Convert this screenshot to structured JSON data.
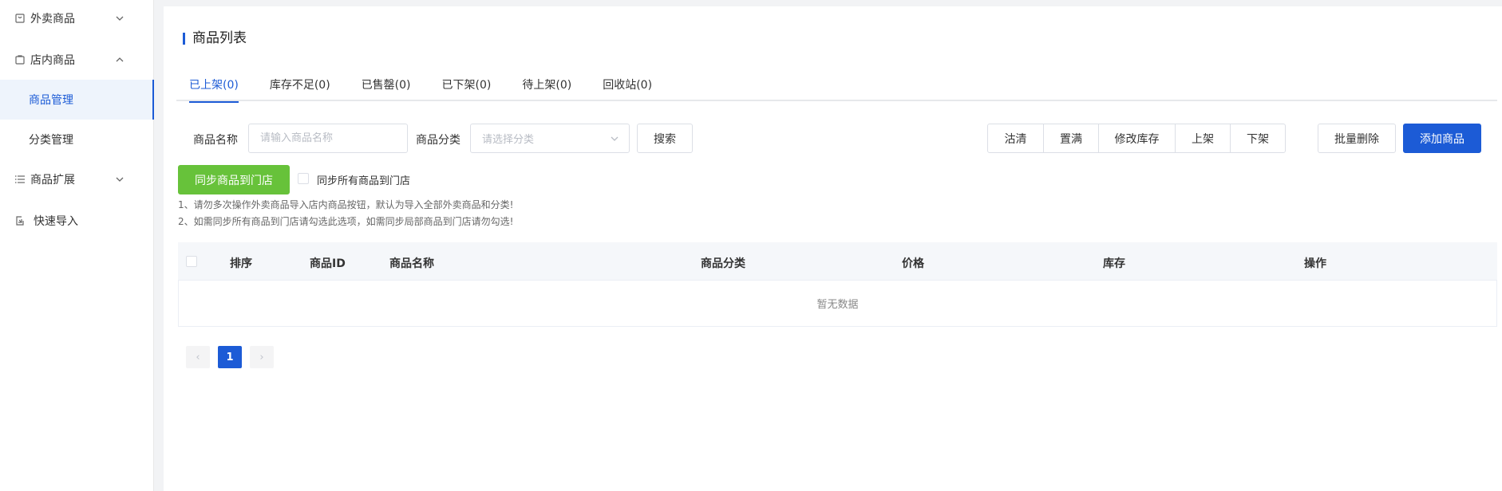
{
  "sidebar": {
    "groups": [
      {
        "label": "外卖商品",
        "icon": "bag-icon",
        "expanded": false
      },
      {
        "label": "店内商品",
        "icon": "shopping-bag-icon",
        "expanded": true
      },
      {
        "label": "商品扩展",
        "icon": "list-icon",
        "expanded": false
      },
      {
        "label": "快速导入",
        "icon": "import-icon"
      }
    ],
    "items": [
      {
        "label": "商品管理",
        "active": true
      },
      {
        "label": "分类管理",
        "active": false
      }
    ]
  },
  "page": {
    "title": "商品列表"
  },
  "tabs": [
    {
      "label": "已上架(0)",
      "active": true
    },
    {
      "label": "库存不足(0)"
    },
    {
      "label": "已售罄(0)"
    },
    {
      "label": "已下架(0)"
    },
    {
      "label": "待上架(0)"
    },
    {
      "label": "回收站(0)"
    }
  ],
  "filters": {
    "name_label": "商品名称",
    "name_placeholder": "请输入商品名称",
    "category_label": "商品分类",
    "category_placeholder": "请选择分类",
    "search_button": "搜索"
  },
  "actions": {
    "group": [
      "沽清",
      "置满",
      "修改库存",
      "上架",
      "下架"
    ],
    "batch_delete": "批量删除",
    "add_product": "添加商品"
  },
  "sync": {
    "button": "同步商品到门店",
    "checkbox_label": "同步所有商品到门店",
    "note1": "1、请勿多次操作外卖商品导入店内商品按钮，默认为导入全部外卖商品和分类!",
    "note2": "2、如需同步所有商品到门店请勾选此选项，如需同步局部商品到门店请勿勾选!"
  },
  "table": {
    "columns": [
      "排序",
      "商品ID",
      "商品名称",
      "商品分类",
      "价格",
      "库存",
      "操作"
    ],
    "empty_text": "暂无数据"
  },
  "pagination": {
    "current": "1",
    "prev": "‹",
    "next": "›"
  },
  "colors": {
    "primary": "#1c5bd6",
    "green": "#67c23a"
  }
}
